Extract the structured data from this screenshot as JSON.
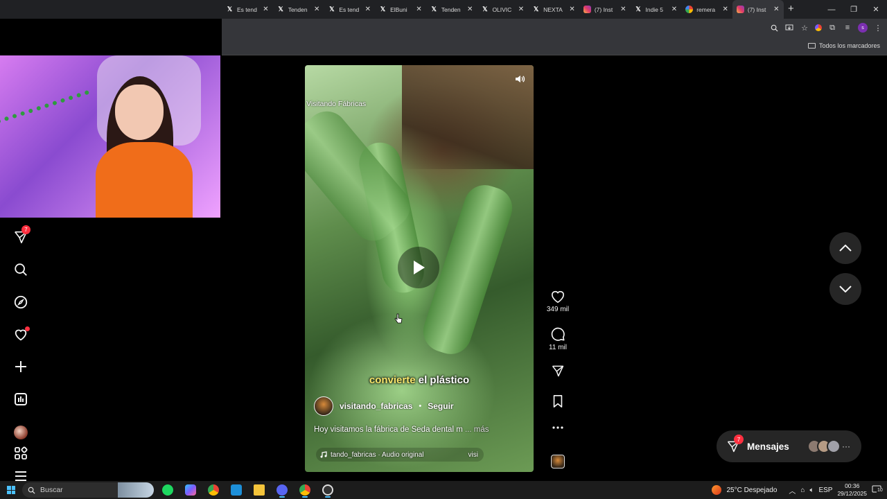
{
  "browser": {
    "tabs": [
      {
        "title": "Es tend",
        "icon": "x-logo-icon"
      },
      {
        "title": "Tenden",
        "icon": "x-logo-icon"
      },
      {
        "title": "Es tend",
        "icon": "x-logo-icon"
      },
      {
        "title": "ElBuni",
        "icon": "x-logo-icon"
      },
      {
        "title": "Tenden",
        "icon": "x-logo-icon"
      },
      {
        "title": "OLIVIC",
        "icon": "x-logo-icon"
      },
      {
        "title": "NEXTA",
        "icon": "x-logo-icon"
      },
      {
        "title": "(7) Inst",
        "icon": "instagram-icon"
      },
      {
        "title": "Indie 5",
        "icon": "x-logo-icon"
      },
      {
        "title": "remera",
        "icon": "google-icon"
      },
      {
        "title": "(7) Inst",
        "icon": "instagram-icon",
        "active": true
      }
    ],
    "bookmarks": {
      "all_label": "Todos los marcadores"
    },
    "profile_initial": "s"
  },
  "instagram": {
    "notifications_badge": "7",
    "reel": {
      "channel_watermark": "Visitando Fábricas",
      "subtitle_highlight": "convierte",
      "subtitle_rest": "el plástico",
      "username": "visitando_fabricas",
      "separator": "•",
      "follow_label": "Seguir",
      "caption": "Hoy visitamos la fábrica de Seda dental m",
      "caption_more": "... más",
      "audio_text": "tando_fabricas · Audio original",
      "audio_trail": "visi"
    },
    "actions": {
      "likes": "349 mil",
      "comments": "11 mil"
    },
    "messages": {
      "label": "Mensajes",
      "badge": "7"
    }
  },
  "taskbar": {
    "search_placeholder": "Buscar",
    "weather": "25°C  Despejado",
    "language": "ESP",
    "time": "00:36",
    "date": "29/12/2025",
    "notif_count": "10"
  }
}
